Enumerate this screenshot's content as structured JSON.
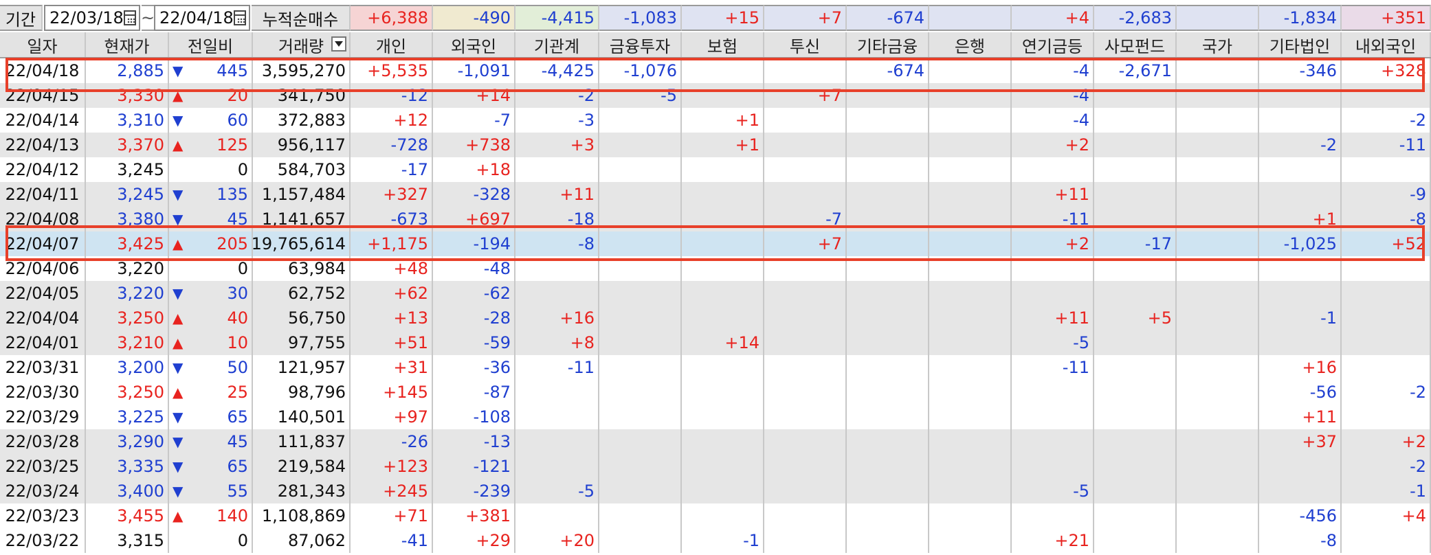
{
  "colors": {
    "up": "#e8231f",
    "down": "#1f3fd0",
    "highlight": "#e8402a"
  },
  "filter": {
    "period_label": "기간",
    "start_date": "22/03/18",
    "end_date": "22/04/18",
    "range_separator": "~",
    "calendar_icon": "calendar-icon",
    "summary_label": "누적순매수",
    "totals": [
      "+6,388",
      "-490",
      "-4,415",
      "-1,083",
      "+15",
      "+7",
      "-674",
      "",
      "+4",
      "-2,683",
      "",
      "-1,834",
      "+351"
    ]
  },
  "columns": [
    "일자",
    "현재가",
    "전일비",
    "거래량",
    "개인",
    "외국인",
    "기관계",
    "금융투자",
    "보험",
    "투신",
    "기타금융",
    "은행",
    "연기금등",
    "사모펀드",
    "국가",
    "기타법인",
    "내외국인"
  ],
  "sort_icon": "dropdown-arrow-icon",
  "rows": [
    {
      "date": "22/04/18",
      "price": "2,885",
      "dir": "down",
      "change": "445",
      "volume": "3,595,270",
      "vals": [
        "+5,535",
        "-1,091",
        "-4,425",
        "-1,076",
        "",
        "",
        "-674",
        "",
        "-4",
        "-2,671",
        "",
        "-346",
        "+328"
      ]
    },
    {
      "date": "22/04/15",
      "price": "3,330",
      "dir": "up",
      "change": "20",
      "volume": "341,750",
      "vals": [
        "-12",
        "+14",
        "-2",
        "-5",
        "",
        "+7",
        "",
        "",
        "-4",
        "",
        "",
        "",
        ""
      ]
    },
    {
      "date": "22/04/14",
      "price": "3,310",
      "dir": "down",
      "change": "60",
      "volume": "372,883",
      "vals": [
        "+12",
        "-7",
        "-3",
        "",
        "+1",
        "",
        "",
        "",
        "-4",
        "",
        "",
        "",
        "-2"
      ]
    },
    {
      "date": "22/04/13",
      "price": "3,370",
      "dir": "up",
      "change": "125",
      "volume": "956,117",
      "vals": [
        "-728",
        "+738",
        "+3",
        "",
        "+1",
        "",
        "",
        "",
        "+2",
        "",
        "",
        "-2",
        "-11"
      ]
    },
    {
      "date": "22/04/12",
      "price": "3,245",
      "dir": "none",
      "change": "0",
      "volume": "584,703",
      "vals": [
        "-17",
        "+18",
        "",
        "",
        "",
        "",
        "",
        "",
        "",
        "",
        "",
        "",
        ""
      ]
    },
    {
      "date": "22/04/11",
      "price": "3,245",
      "dir": "down",
      "change": "135",
      "volume": "1,157,484",
      "vals": [
        "+327",
        "-328",
        "+11",
        "",
        "",
        "",
        "",
        "",
        "+11",
        "",
        "",
        "",
        "-9"
      ]
    },
    {
      "date": "22/04/08",
      "price": "3,380",
      "dir": "down",
      "change": "45",
      "volume": "1,141,657",
      "vals": [
        "-673",
        "+697",
        "-18",
        "",
        "",
        "-7",
        "",
        "",
        "-11",
        "",
        "",
        "+1",
        "-8"
      ]
    },
    {
      "date": "22/04/07",
      "price": "3,425",
      "dir": "up",
      "change": "205",
      "volume": "19,765,614",
      "vals": [
        "+1,175",
        "-194",
        "-8",
        "",
        "",
        "+7",
        "",
        "",
        "+2",
        "-17",
        "",
        "-1,025",
        "+52"
      ]
    },
    {
      "date": "22/04/06",
      "price": "3,220",
      "dir": "none",
      "change": "0",
      "volume": "63,984",
      "vals": [
        "+48",
        "-48",
        "",
        "",
        "",
        "",
        "",
        "",
        "",
        "",
        "",
        "",
        ""
      ]
    },
    {
      "date": "22/04/05",
      "price": "3,220",
      "dir": "down",
      "change": "30",
      "volume": "62,752",
      "vals": [
        "+62",
        "-62",
        "",
        "",
        "",
        "",
        "",
        "",
        "",
        "",
        "",
        "",
        ""
      ]
    },
    {
      "date": "22/04/04",
      "price": "3,250",
      "dir": "up",
      "change": "40",
      "volume": "56,750",
      "vals": [
        "+13",
        "-28",
        "+16",
        "",
        "",
        "",
        "",
        "",
        "+11",
        "+5",
        "",
        "-1",
        ""
      ]
    },
    {
      "date": "22/04/01",
      "price": "3,210",
      "dir": "up",
      "change": "10",
      "volume": "97,755",
      "vals": [
        "+51",
        "-59",
        "+8",
        "",
        "+14",
        "",
        "",
        "",
        "-5",
        "",
        "",
        "",
        ""
      ]
    },
    {
      "date": "22/03/31",
      "price": "3,200",
      "dir": "down",
      "change": "50",
      "volume": "121,957",
      "vals": [
        "+31",
        "-36",
        "-11",
        "",
        "",
        "",
        "",
        "",
        "-11",
        "",
        "",
        "+16",
        ""
      ]
    },
    {
      "date": "22/03/30",
      "price": "3,250",
      "dir": "up",
      "change": "25",
      "volume": "98,796",
      "vals": [
        "+145",
        "-87",
        "",
        "",
        "",
        "",
        "",
        "",
        "",
        "",
        "",
        "-56",
        "-2"
      ]
    },
    {
      "date": "22/03/29",
      "price": "3,225",
      "dir": "down",
      "change": "65",
      "volume": "140,501",
      "vals": [
        "+97",
        "-108",
        "",
        "",
        "",
        "",
        "",
        "",
        "",
        "",
        "",
        "+11",
        ""
      ]
    },
    {
      "date": "22/03/28",
      "price": "3,290",
      "dir": "down",
      "change": "45",
      "volume": "111,837",
      "vals": [
        "-26",
        "-13",
        "",
        "",
        "",
        "",
        "",
        "",
        "",
        "",
        "",
        "+37",
        "+2"
      ]
    },
    {
      "date": "22/03/25",
      "price": "3,335",
      "dir": "down",
      "change": "65",
      "volume": "219,584",
      "vals": [
        "+123",
        "-121",
        "",
        "",
        "",
        "",
        "",
        "",
        "",
        "",
        "",
        "",
        "-2"
      ]
    },
    {
      "date": "22/03/24",
      "price": "3,400",
      "dir": "down",
      "change": "55",
      "volume": "281,343",
      "vals": [
        "+245",
        "-239",
        "-5",
        "",
        "",
        "",
        "",
        "",
        "-5",
        "",
        "",
        "",
        "-1"
      ]
    },
    {
      "date": "22/03/23",
      "price": "3,455",
      "dir": "up",
      "change": "140",
      "volume": "1,108,869",
      "vals": [
        "+71",
        "+381",
        "",
        "",
        "",
        "",
        "",
        "",
        "",
        "",
        "",
        "-456",
        "+4"
      ]
    },
    {
      "date": "22/03/22",
      "price": "3,315",
      "dir": "none",
      "change": "0",
      "volume": "87,062",
      "vals": [
        "-41",
        "+29",
        "+20",
        "",
        "-1",
        "",
        "",
        "",
        "+21",
        "",
        "",
        "-8",
        ""
      ]
    }
  ]
}
